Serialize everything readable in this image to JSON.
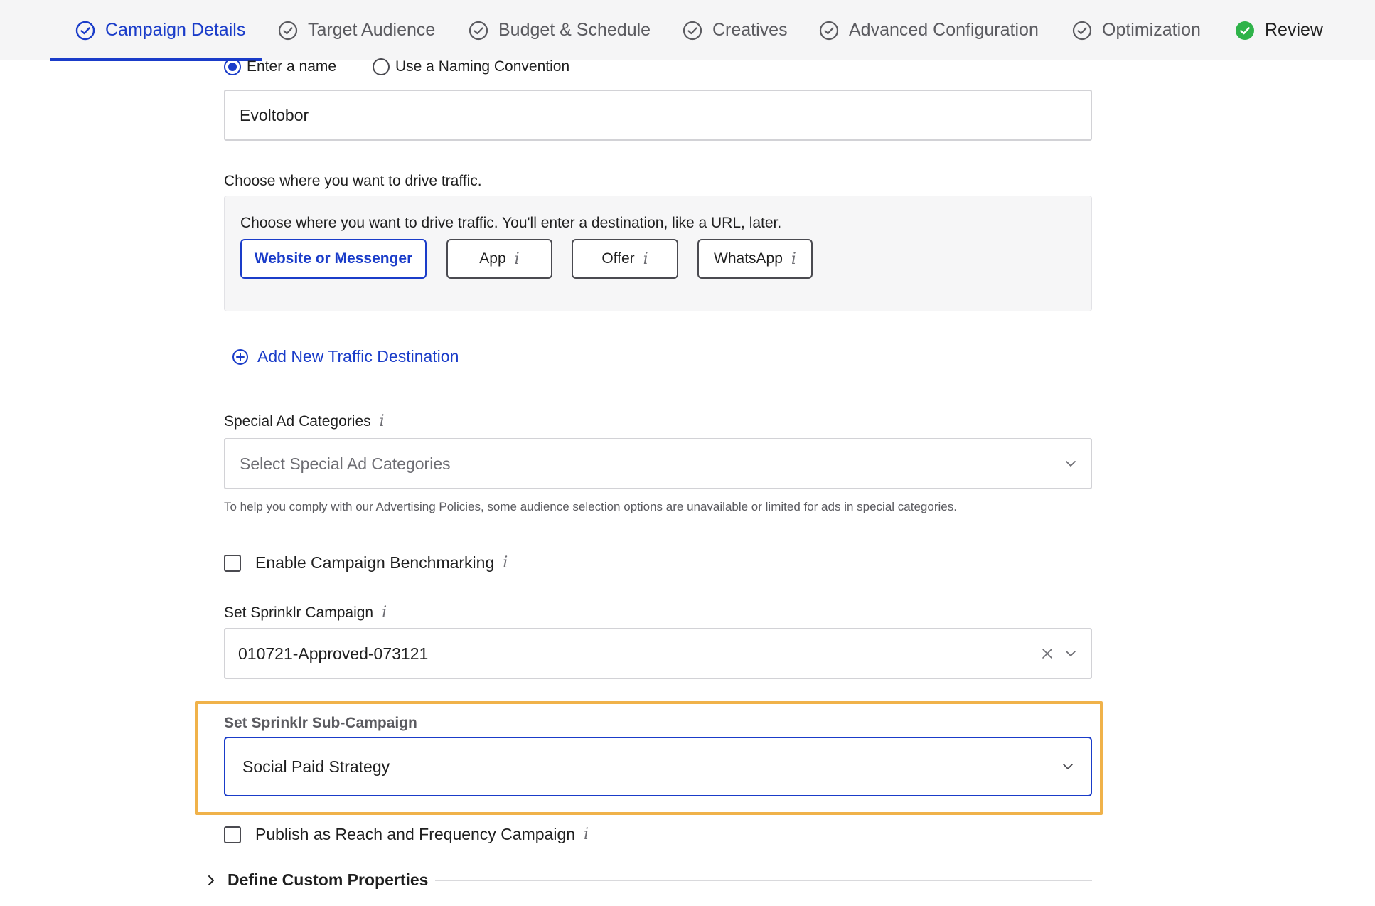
{
  "steps": [
    {
      "label": "Campaign Details",
      "state": "active"
    },
    {
      "label": "Target Audience",
      "state": "todo"
    },
    {
      "label": "Budget & Schedule",
      "state": "todo"
    },
    {
      "label": "Creatives",
      "state": "todo"
    },
    {
      "label": "Advanced Configuration",
      "state": "todo"
    },
    {
      "label": "Optimization",
      "state": "todo"
    },
    {
      "label": "Review",
      "state": "done"
    }
  ],
  "naming": {
    "option_enter": "Enter a name",
    "option_convention": "Use a Naming Convention",
    "selected": "Enter a name",
    "name_value": "Evoltobor"
  },
  "traffic": {
    "label": "Choose where you want to drive traffic.",
    "panel_text": "Choose where you want to drive traffic. You'll enter a destination, like a URL, later.",
    "options": [
      "Website or Messenger",
      "App",
      "Offer",
      "WhatsApp"
    ],
    "selected": "Website or Messenger",
    "add_link": "Add New Traffic Destination"
  },
  "special_ad": {
    "label": "Special Ad Categories",
    "placeholder": "Select Special Ad Categories",
    "helper": "To help you comply with our Advertising Policies, some audience selection options are unavailable or limited for ads in special categories."
  },
  "benchmarking": {
    "label": "Enable Campaign Benchmarking",
    "checked": false
  },
  "sprinklr_campaign": {
    "label": "Set Sprinklr Campaign",
    "value": "010721-Approved-073121"
  },
  "sub_campaign": {
    "label": "Set Sprinklr Sub-Campaign",
    "value": "Social Paid Strategy"
  },
  "reach_frequency": {
    "label": "Publish as Reach and Frequency Campaign",
    "checked": false
  },
  "custom_properties": {
    "label": "Define Custom Properties"
  },
  "colors": {
    "accent": "#1a3cc9",
    "highlight": "#f0b24a",
    "success": "#2fb34a"
  },
  "icons": {
    "step_todo": "check-circle-outline-icon",
    "step_done": "check-circle-filled-icon",
    "info": "info-icon",
    "add": "plus-circle-icon",
    "chevron": "chevron-down-icon",
    "clear": "close-icon",
    "expand": "chevron-right-icon"
  }
}
